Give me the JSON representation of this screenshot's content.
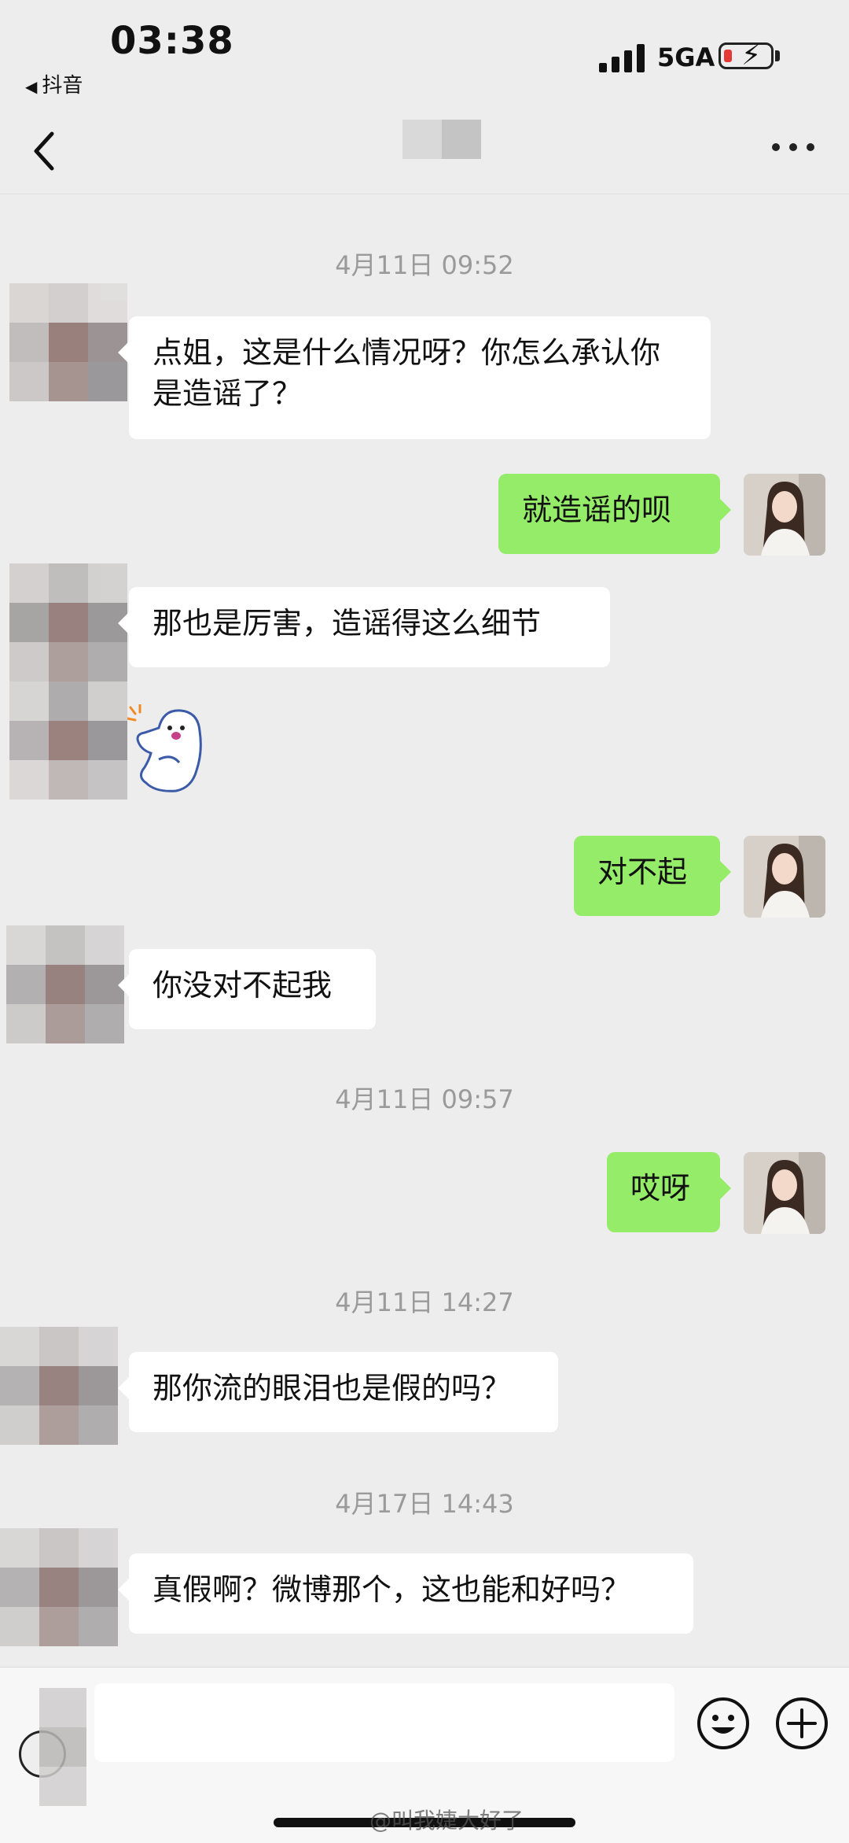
{
  "status_bar": {
    "time": "03:38",
    "back_app": "抖音",
    "network": "5GA"
  },
  "nav": {
    "back_icon": "chevron-left-icon",
    "more_icon": "more-dots-icon"
  },
  "messages": {
    "ts1": "4月11日 09:52",
    "m1": "点姐，这是什么情况呀？你怎么承认你是造谣了？",
    "m2": "就造谣的呗",
    "m3": "那也是厉害，造谣得这么细节",
    "m4": "对不起",
    "m5": "你没对不起我",
    "ts2": "4月11日 09:57",
    "m6": "哎呀",
    "ts3": "4月11日 14:27",
    "m7": "那你流的眼泪也是假的吗？",
    "ts4": "4月17日 14:43",
    "m8": "真假啊？微博那个，这也能和好吗？"
  },
  "input_bar": {
    "voice_icon": "voice-icon",
    "emoji_icon": "emoji-icon",
    "add_icon": "plus-circle-icon"
  },
  "watermark": "@叫我婕大好了",
  "colors": {
    "background": "#ededed",
    "self_bubble": "#95ec69",
    "other_bubble": "#ffffff",
    "timestamp": "#9a9a9a"
  }
}
